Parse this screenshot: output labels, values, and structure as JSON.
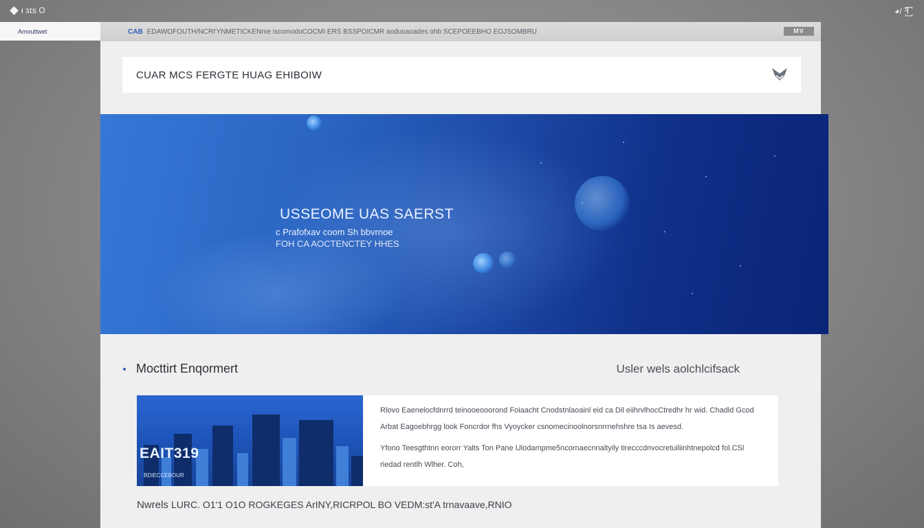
{
  "system": {
    "top_left_text": "ᵻ ᴈɪꜱ O",
    "top_right_text": "◕/ ꟻ꙱"
  },
  "sidebar": {
    "tab_label": "Amouttwet"
  },
  "urlbar": {
    "prefix": "CAB",
    "text": "EDAWOFOUTH/NCRI'YNMETICKENme iscomodoCOCMI ERS BSSPOICMR aoduoaoades ohb SCEPOEEBHO EOJSOMBRU",
    "badge": "MV"
  },
  "title_card": {
    "title": "CUAR  MCS FERGTE HUAG EHIBOIW",
    "logo_icon": "brand-logo-icon"
  },
  "hero": {
    "headline": "USSEOME UAS SAERST",
    "subline": "c Prafofxav coom Sh bbvrnoe",
    "subline2": "FOH CA  AOCTENCTEY HHES"
  },
  "section": {
    "heading": "Mocttirt Enqormert",
    "right_label": "Usler wels aolchlcifsack"
  },
  "card": {
    "thumb_label": "EAIT319",
    "thumb_caption": "BDIECCEBOUR",
    "paragraphs": [
      "Rlovo Eaenelocfdnrrd teinooeooorond Foiaacht Cnodstnlaoainl eid ca Dil eiihrvlhocCtredhr hr wid. Chadld Gcod",
      "Arbat Eagoebhrgg look Foncrdor fhs Vyoycker csnomecinoolnorsnrrnehshre tsa Is aevesd.",
      "Yfono Teesgthtnn eororr Yalts Ton Pane Ulodampme5ncornaecnnaltyily tirecccdnvocretuiliinhtnepolcd fol.CSl",
      "riedad rentlh Wlher. Coh,"
    ]
  },
  "footer": {
    "lead": "Nwrels",
    "rest": "LURC. O1'1 O1O ROGKEGES ArINY,RICRPOL BO VEDM:st'A trnavaave,RNIO"
  },
  "colors": {
    "accent": "#2f5fb7",
    "hero_start": "#3578d6",
    "hero_end": "#0a2377",
    "page_bg": "#efeff0",
    "desktop_bg": "#8a8a8a"
  }
}
